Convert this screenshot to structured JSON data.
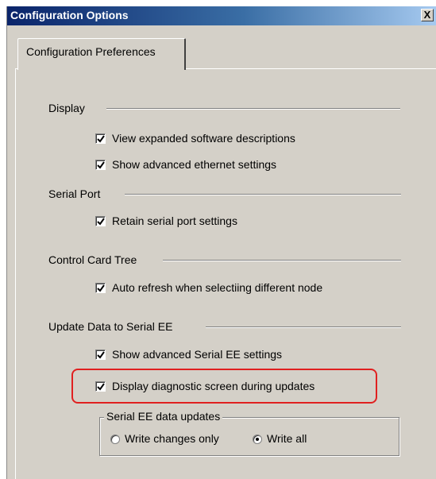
{
  "window": {
    "title": "Configuration Options",
    "close_label": "X"
  },
  "tab": {
    "label": "Configuration Preferences"
  },
  "sections": {
    "display": {
      "label": "Display",
      "options": [
        {
          "label": "View expanded software descriptions",
          "checked": true
        },
        {
          "label": "Show advanced ethernet settings",
          "checked": true
        }
      ]
    },
    "serial_port": {
      "label": "Serial Port",
      "options": [
        {
          "label": "Retain serial port settings",
          "checked": true
        }
      ]
    },
    "control_card_tree": {
      "label": "Control Card Tree",
      "options": [
        {
          "label": "Auto refresh when selectiing different node",
          "checked": true
        }
      ]
    },
    "update_data": {
      "label": "Update Data to Serial EE",
      "options": [
        {
          "label": "Show advanced Serial EE settings",
          "checked": true
        },
        {
          "label": "Display diagnostic screen during updates",
          "checked": true
        }
      ]
    }
  },
  "serial_ee_updates": {
    "title": "Serial EE data updates",
    "options": [
      {
        "label": "Write changes only",
        "selected": false
      },
      {
        "label": "Write all",
        "selected": true
      }
    ]
  },
  "colors": {
    "face": "#d4d0c8",
    "title_start": "#0a246a",
    "title_end": "#a6caf0",
    "highlight": "#e02020"
  }
}
